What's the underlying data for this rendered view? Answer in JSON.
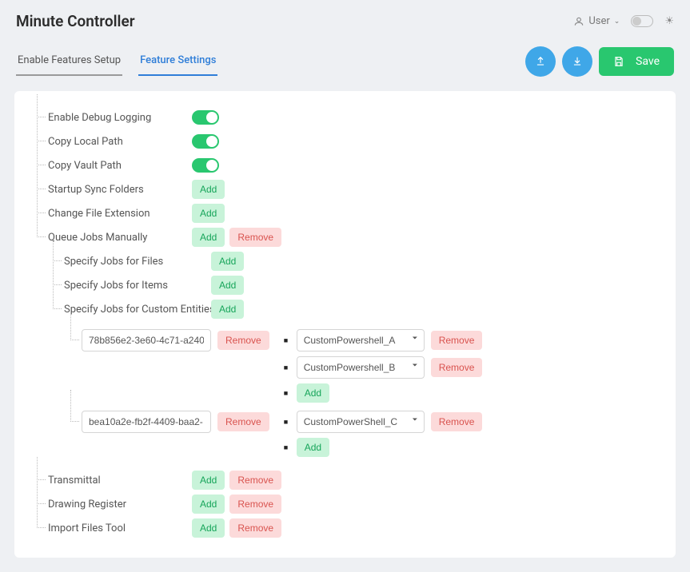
{
  "header": {
    "title": "Minute Controller",
    "user_label": "User"
  },
  "tabs": {
    "setup": "Enable Features Setup",
    "settings": "Feature Settings"
  },
  "actions": {
    "save": "Save"
  },
  "labels": {
    "add": "Add",
    "remove": "Remove"
  },
  "settings": {
    "debug": "Enable Debug Logging",
    "copy_local": "Copy Local Path",
    "copy_vault": "Copy Vault Path",
    "startup_sync": "Startup Sync Folders",
    "change_ext": "Change File Extension",
    "queue_jobs": "Queue Jobs Manually",
    "spec_files": "Specify Jobs for Files",
    "spec_items": "Specify Jobs for Items",
    "spec_custom": "Specify Jobs for Custom Entities",
    "transmittal": "Transmittal",
    "drawing_reg": "Drawing Register",
    "import_tool": "Import Files Tool"
  },
  "custom_entities": [
    {
      "guid": "78b856e2-3e60-4c71-a240",
      "scripts": [
        "CustomPowershell_A",
        "CustomPowershell_B"
      ]
    },
    {
      "guid": "bea10a2e-fb2f-4409-baa2-",
      "scripts": [
        "CustomPowerShell_C"
      ]
    }
  ]
}
